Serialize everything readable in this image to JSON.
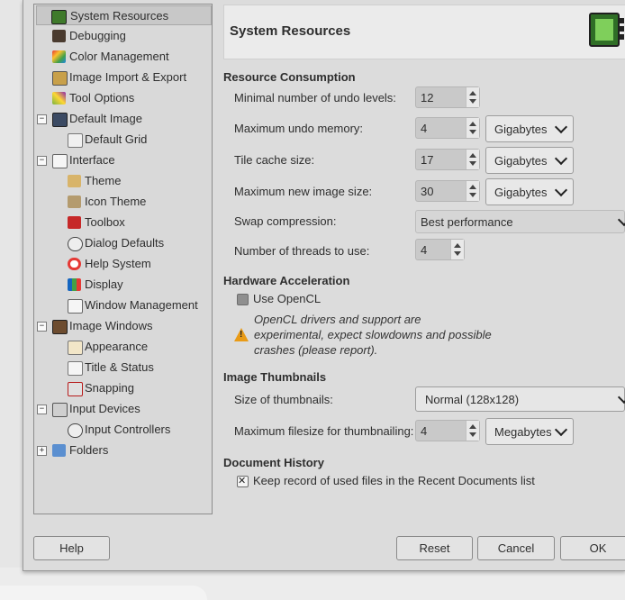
{
  "tree": {
    "items": [
      {
        "label": "System Resources"
      },
      {
        "label": "Debugging"
      },
      {
        "label": "Color Management"
      },
      {
        "label": "Image Import & Export"
      },
      {
        "label": "Tool Options"
      },
      {
        "label": "Default Image"
      },
      {
        "label": "Default Grid"
      },
      {
        "label": "Interface"
      },
      {
        "label": "Theme"
      },
      {
        "label": "Icon Theme"
      },
      {
        "label": "Toolbox"
      },
      {
        "label": "Dialog Defaults"
      },
      {
        "label": "Help System"
      },
      {
        "label": "Display"
      },
      {
        "label": "Window Management"
      },
      {
        "label": "Image Windows"
      },
      {
        "label": "Appearance"
      },
      {
        "label": "Title & Status"
      },
      {
        "label": "Snapping"
      },
      {
        "label": "Input Devices"
      },
      {
        "label": "Input Controllers"
      },
      {
        "label": "Folders"
      }
    ],
    "expander_minus": "−",
    "expander_plus": "+"
  },
  "header": {
    "title": "System Resources"
  },
  "resource": {
    "section": "Resource Consumption",
    "undo_levels_label": "Minimal number of undo levels:",
    "undo_levels_value": "12",
    "undo_memory_label": "Maximum undo memory:",
    "undo_memory_value": "4",
    "undo_memory_unit": "Gigabytes",
    "tile_cache_label": "Tile cache size:",
    "tile_cache_value": "17",
    "tile_cache_unit": "Gigabytes",
    "new_image_label": "Maximum new image size:",
    "new_image_value": "30",
    "new_image_unit": "Gigabytes",
    "swap_label": "Swap compression:",
    "swap_value": "Best performance",
    "threads_label": "Number of threads to use:",
    "threads_value": "4"
  },
  "hardware": {
    "section": "Hardware Acceleration",
    "opencl_label": "Use OpenCL",
    "warning": "OpenCL drivers and support are experimental, expect slowdowns and possible crashes (please report)."
  },
  "thumbs": {
    "section": "Image Thumbnails",
    "size_label": "Size of thumbnails:",
    "size_value": "Normal (128x128)",
    "filesize_label": "Maximum filesize for thumbnailing:",
    "filesize_value": "4",
    "filesize_unit": "Megabytes"
  },
  "history": {
    "section": "Document History",
    "keep_label": "Keep record of used files in the Recent Documents list"
  },
  "buttons": {
    "help": "Help",
    "reset": "Reset",
    "cancel": "Cancel",
    "ok": "OK"
  }
}
